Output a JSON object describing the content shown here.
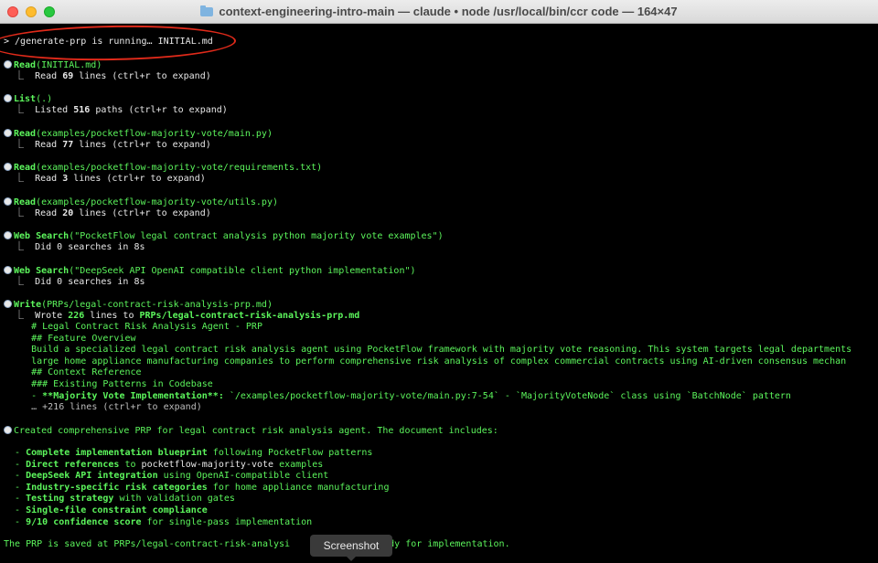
{
  "window": {
    "title": "context-engineering-intro-main — claude • node /usr/local/bin/ccr code — 164×47"
  },
  "prompt": "> /generate-prp is running… INITIAL.md",
  "entries": [
    {
      "tool": "Read",
      "args": "(INITIAL.md)",
      "result_pre": "  ⎿  Read ",
      "result_num": "69",
      "result_post": " lines (ctrl+r to expand)"
    },
    {
      "tool": "List",
      "args": "(.)",
      "result_pre": "  ⎿  Listed ",
      "result_num": "516",
      "result_post": " paths (ctrl+r to expand)"
    },
    {
      "tool": "Read",
      "args": "(examples/pocketflow-majority-vote/main.py)",
      "result_pre": "  ⎿  Read ",
      "result_num": "77",
      "result_post": " lines (ctrl+r to expand)"
    },
    {
      "tool": "Read",
      "args": "(examples/pocketflow-majority-vote/requirements.txt)",
      "result_pre": "  ⎿  Read ",
      "result_num": "3",
      "result_post": " lines (ctrl+r to expand)"
    },
    {
      "tool": "Read",
      "args": "(examples/pocketflow-majority-vote/utils.py)",
      "result_pre": "  ⎿  Read ",
      "result_num": "20",
      "result_post": " lines (ctrl+r to expand)"
    },
    {
      "tool": "Web Search",
      "args": "(\"PocketFlow legal contract analysis python majority vote examples\")",
      "result_pre": "  ⎿  Did 0 searches in 8s",
      "result_num": "",
      "result_post": ""
    },
    {
      "tool": "Web Search",
      "args": "(\"DeepSeek API OpenAI compatible client python implementation\")",
      "result_pre": "  ⎿  Did 0 searches in 8s",
      "result_num": "",
      "result_post": ""
    }
  ],
  "write": {
    "tool": "Write",
    "args": "(PRPs/legal-contract-risk-analysis-prp.md)",
    "wrote_pre": "  ⎿  Wrote ",
    "wrote_num": "226",
    "wrote_mid": " lines to ",
    "wrote_file": "PRPs/legal-contract-risk-analysis-prp.md",
    "lines": [
      "     # Legal Contract Risk Analysis Agent - PRP",
      "     ## Feature Overview",
      "     Build a specialized legal contract risk analysis agent using PocketFlow framework with majority vote reasoning. This system targets legal departments",
      "     large home appliance manufacturing companies to perform comprehensive risk analysis of complex commercial contracts using AI-driven consensus mechan",
      "     ## Context Reference",
      "     ### Existing Patterns in Codebase"
    ],
    "bullet_pre": "     - ",
    "bullet_bold": "**Majority Vote Implementation**:",
    "bullet_post": " `/examples/pocketflow-majority-vote/main.py:7-54` - `MajorityVoteNode` class using `BatchNode` pattern",
    "more": "     … +216 lines (ctrl+r to expand)"
  },
  "summary": {
    "intro": "Created comprehensive PRP for legal contract risk analysis agent. The document includes:",
    "items": [
      {
        "bold": "Complete implementation blueprint",
        "rest": " following PocketFlow patterns"
      },
      {
        "bold": "Direct references",
        "rest": " to ",
        "extra": "pocketflow-majority-vote",
        "tail": " examples"
      },
      {
        "bold": "DeepSeek API integration",
        "rest": " using OpenAI-compatible client"
      },
      {
        "bold": "Industry-specific risk categories",
        "rest": " for home appliance manufacturing"
      },
      {
        "bold": "Testing strategy",
        "rest": " with validation gates"
      },
      {
        "bold": "Single-file constraint compliance",
        "rest": ""
      },
      {
        "bold": "9/10 confidence score",
        "rest": " for single-pass implementation"
      }
    ],
    "saved_pre": "The PRP is saved at ",
    "saved_path": "PRPs/legal-contract-risk-analysi",
    "saved_post": "ready for implementation."
  },
  "tooltip": "Screenshot",
  "colors": {
    "accent_green": "#5cf55c",
    "annotation_red": "#e02a1a",
    "terminal_bg": "#000000"
  }
}
